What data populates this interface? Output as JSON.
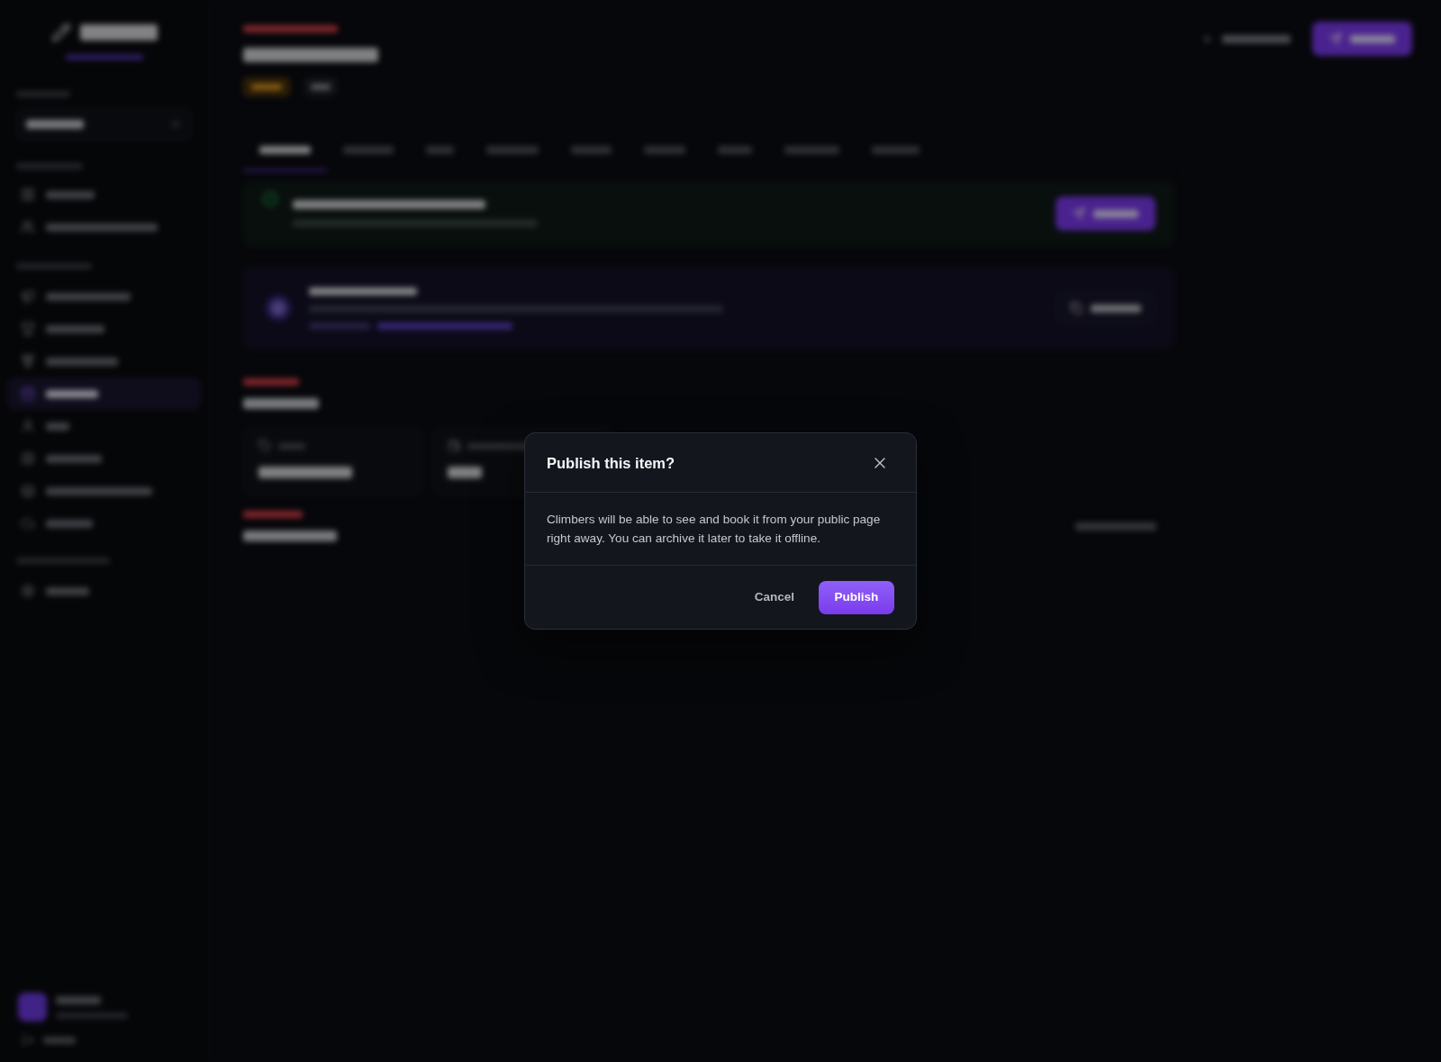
{
  "sidebar": {
    "nav_groups": [
      {
        "items": [
          {
            "selected": false
          },
          {
            "selected": false
          }
        ]
      },
      {
        "items": [
          {
            "selected": false
          },
          {
            "selected": false
          },
          {
            "selected": false
          },
          {
            "selected": true
          },
          {
            "selected": false
          },
          {
            "selected": false
          },
          {
            "selected": false
          },
          {
            "selected": false
          }
        ]
      },
      {
        "items": [
          {
            "selected": false
          }
        ]
      }
    ]
  },
  "header": {
    "badges": [
      {
        "kind": "status"
      },
      {
        "kind": "plain"
      }
    ]
  },
  "tabs": [
    {
      "selected": true
    },
    {
      "selected": false
    },
    {
      "selected": false
    },
    {
      "selected": false
    },
    {
      "selected": false
    },
    {
      "selected": false
    },
    {
      "selected": false
    },
    {
      "selected": false
    },
    {
      "selected": false
    }
  ],
  "dialog": {
    "title": "Publish this item?",
    "body": "Climbers will be able to see and book it from your public page right away. You can archive it later to take it offline.",
    "buttons": [
      {
        "label": "Cancel",
        "kind": "secondary"
      },
      {
        "label": "Publish",
        "kind": "primary"
      }
    ]
  }
}
